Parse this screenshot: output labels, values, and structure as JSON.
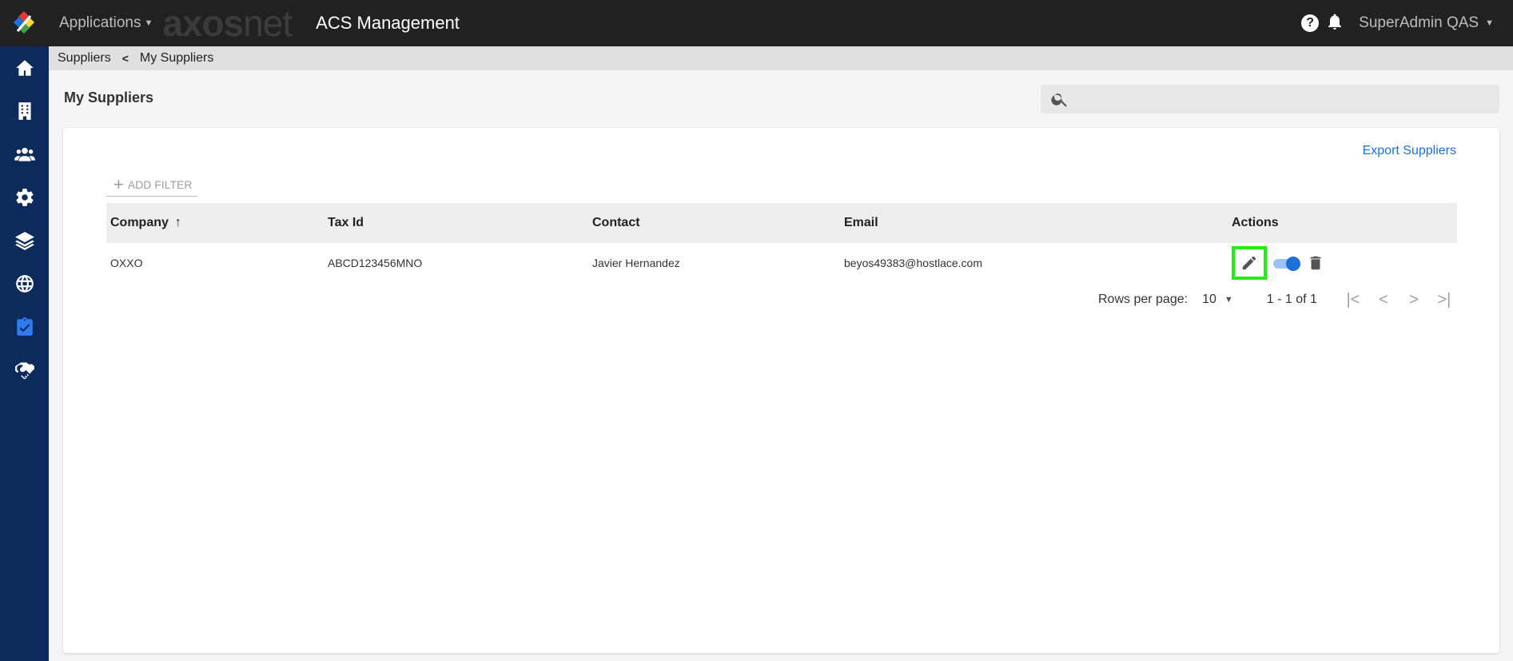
{
  "topbar": {
    "apps_label": "Applications",
    "brand_bold": "axos",
    "brand_light": "net",
    "module_title": "ACS Management",
    "help_symbol": "?",
    "user_label": "SuperAdmin QAS"
  },
  "breadcrumb": {
    "parent": "Suppliers",
    "current": "My Suppliers"
  },
  "page": {
    "title": "My Suppliers",
    "search_placeholder": ""
  },
  "card": {
    "export_label": "Export Suppliers",
    "add_filter_label": "ADD FILTER"
  },
  "table": {
    "columns": [
      "Company",
      "Tax Id",
      "Contact",
      "Email",
      "Actions"
    ],
    "rows": [
      {
        "company": "OXXO",
        "tax_id": "ABCD123456MNO",
        "contact": "Javier Hernandez",
        "email": "beyos49383@hostlace.com",
        "active": true
      }
    ]
  },
  "pagination": {
    "rows_per_page_label": "Rows per page:",
    "rows_per_page_value": "10",
    "range": "1 - 1 of 1"
  },
  "sidebar_icons": [
    "home-icon",
    "building-icon",
    "users-icon",
    "gear-icon",
    "layers-icon",
    "globe-icon",
    "clipboard-check-icon",
    "handshake-icon"
  ],
  "colors": {
    "topbar": "#212121",
    "sidebar": "#0d2a5c",
    "accent": "#1e6fd9",
    "highlight": "#22ee11"
  }
}
